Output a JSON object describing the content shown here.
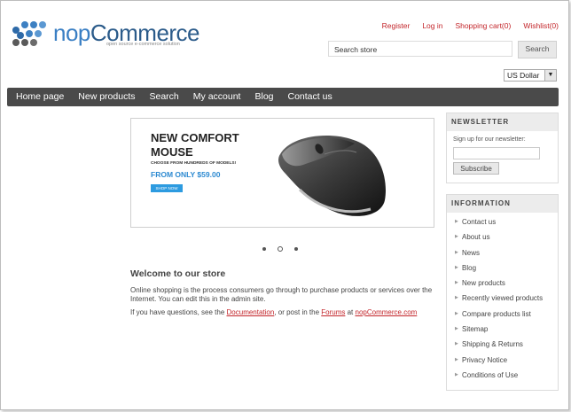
{
  "header": {
    "logo_text_a": "nop",
    "logo_text_b": "Commerce",
    "logo_tagline": "open source e-commerce solution",
    "links": [
      "Register",
      "Log in",
      "Shopping cart(0)",
      "Wishlist(0)"
    ]
  },
  "search": {
    "value": "Search store",
    "button": "Search"
  },
  "currency": {
    "selected": "US Dollar"
  },
  "nav": {
    "items": [
      "Home page",
      "New products",
      "Search",
      "My account",
      "Blog",
      "Contact us"
    ]
  },
  "slider": {
    "title": "NEW COMFORT MOUSE",
    "subtitle": "CHOOSE FROM HUNDREDS OF MODELS!",
    "price": "FROM ONLY $59.00",
    "cta": "SHOP NOW",
    "page_count": 3,
    "active_page": 2
  },
  "welcome": {
    "title": "Welcome to our store",
    "p1": "Online shopping is the process consumers go through to purchase products or services over the Internet. You can edit this in the admin site.",
    "p2_a": "If you have questions, see the ",
    "p2_link1": "Documentation",
    "p2_b": ", or post in the ",
    "p2_link2": "Forums",
    "p2_c": " at ",
    "p2_link3": "nopCommerce.com"
  },
  "newsletter": {
    "title": "NEWSLETTER",
    "label": "Sign up for our newsletter:",
    "button": "Subscribe"
  },
  "information": {
    "title": "INFORMATION",
    "items": [
      "Contact us",
      "About us",
      "News",
      "Blog",
      "New products",
      "Recently viewed products",
      "Compare products list",
      "Sitemap",
      "Shipping & Returns",
      "Privacy Notice",
      "Conditions of Use"
    ]
  },
  "colors": {
    "link_red": "#c3252a",
    "nav_bg": "#4a4a4a",
    "brand_blue": "#2b5b8a",
    "accent_blue": "#2d8ad1"
  }
}
